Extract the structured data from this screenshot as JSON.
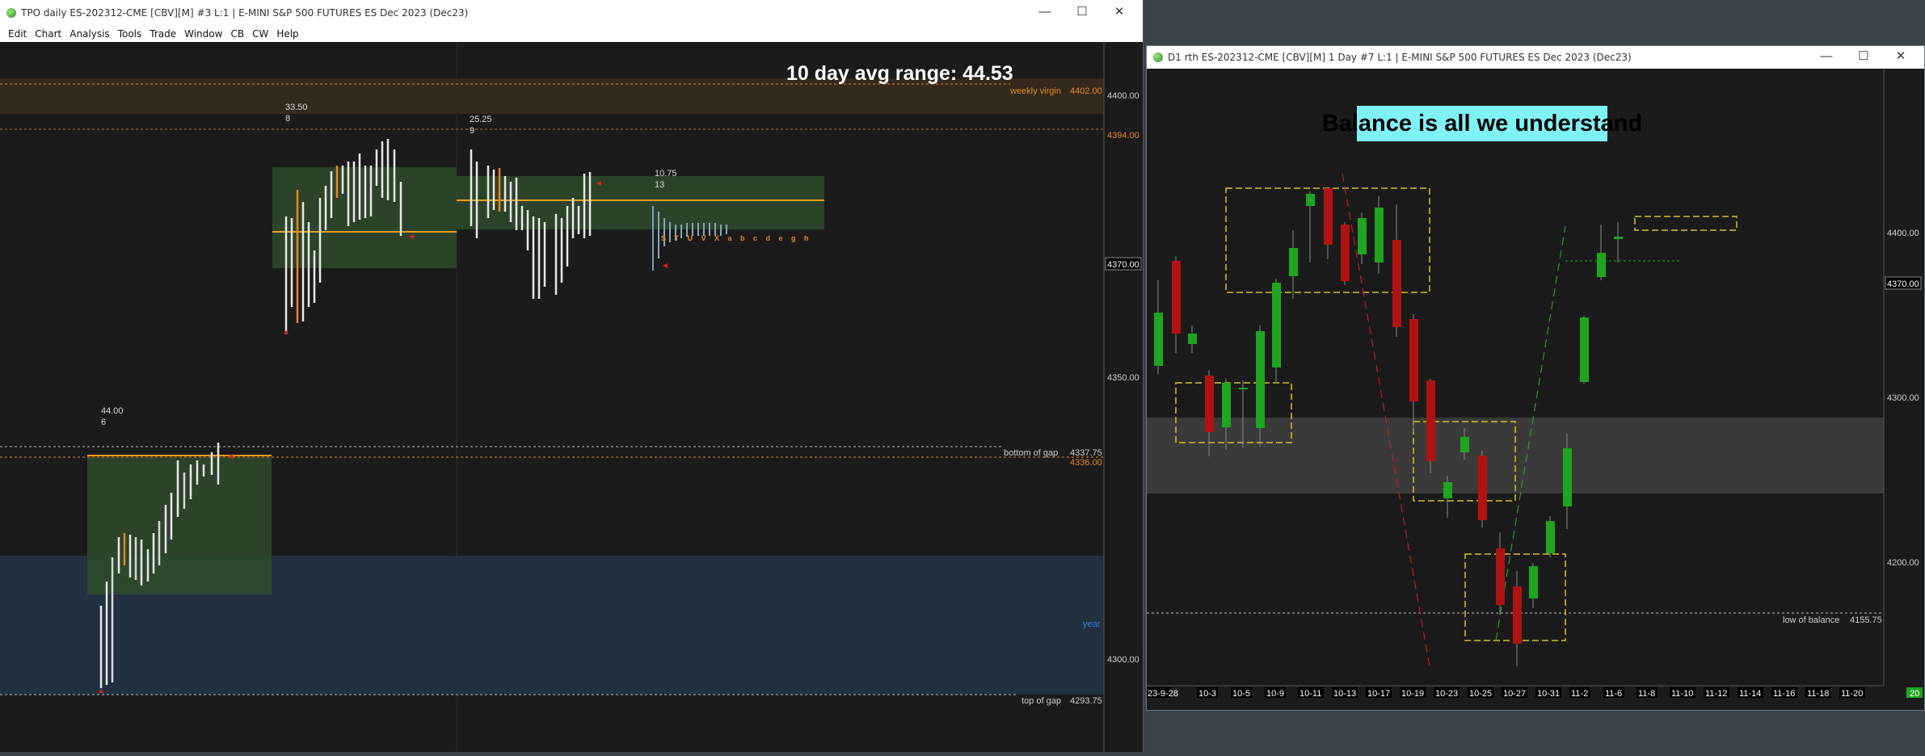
{
  "tpo_window": {
    "title": "TPO daily ES-202312-CME [CBV][M] #3 L:1 | E-MINI S&P 500 FUTURES ES Dec 2023 (Dec23)",
    "menu": [
      "Edit",
      "Chart",
      "Analysis",
      "Tools",
      "Trade",
      "Window",
      "CB",
      "CW",
      "Help"
    ],
    "controls": {
      "minimize": "—",
      "maximize": "☐",
      "close": "✕"
    },
    "avg_range_text": "10 day avg range:  44.53",
    "price_axis": [
      "4400.00",
      "4394.00",
      "4370.00",
      "4350.00",
      "4336.00",
      "4337.75",
      "4300.00",
      "4293.75",
      "4402.00"
    ],
    "price_labels": {
      "p4400": "4400.00",
      "p4394": "4394.00",
      "p4370": "4370.00",
      "p4350": "4350.00",
      "p4300": "4300.00"
    },
    "level_labels": {
      "weekly_virgin": "weekly virgin",
      "weekly_virgin_price": "4402.00",
      "bottom_gap": "bottom of gap",
      "bottom_gap_price": "4337.75",
      "p4336": "4336.00",
      "top_gap": "top of gap",
      "top_gap_price": "4293.75",
      "year": "year"
    },
    "profile_stats": [
      {
        "range": "44.00",
        "count": "6"
      },
      {
        "range": "33.50",
        "count": "8"
      },
      {
        "range": "25.25",
        "count": "9"
      },
      {
        "range": "10.75",
        "count": "13"
      }
    ],
    "tpo_letters": "S T U V X a b c d e g h",
    "colors": {
      "orange": "#e8871e",
      "value_area": "#2f4a2c",
      "gap": "#22303f",
      "red": "#e0201e"
    }
  },
  "d1_window": {
    "title": "D1 rth ES-202312-CME [CBV][M]  1 Day  #7 L:1 | E-MINI S&P 500 FUTURES ES Dec 2023 (Dec23)",
    "controls": {
      "minimize": "—",
      "maximize": "☐",
      "close": "✕"
    },
    "banner": "Balance is all we understand",
    "price_labels": {
      "p4400": "4400.00",
      "p4370": "4370.00",
      "p4300": "4300.00",
      "p4200": "4200.00",
      "p4155": "4155.75"
    },
    "low_balance": "low of balance",
    "dates": [
      "23-9-28",
      "10-3",
      "10-5",
      "10-9",
      "10-11",
      "10-13",
      "10-17",
      "10-19",
      "10-23",
      "10-25",
      "10-27",
      "10-31",
      "11-2",
      "11-6",
      "11-8",
      "11-10",
      "11-12",
      "11-14",
      "11-16",
      "11-18",
      "11-20"
    ],
    "corner_badge": "20",
    "colors": {
      "bull": "#1fa51f",
      "bear": "#b01212",
      "banner_bg": "#7ef2f5",
      "box": "#d8c21a"
    }
  }
}
